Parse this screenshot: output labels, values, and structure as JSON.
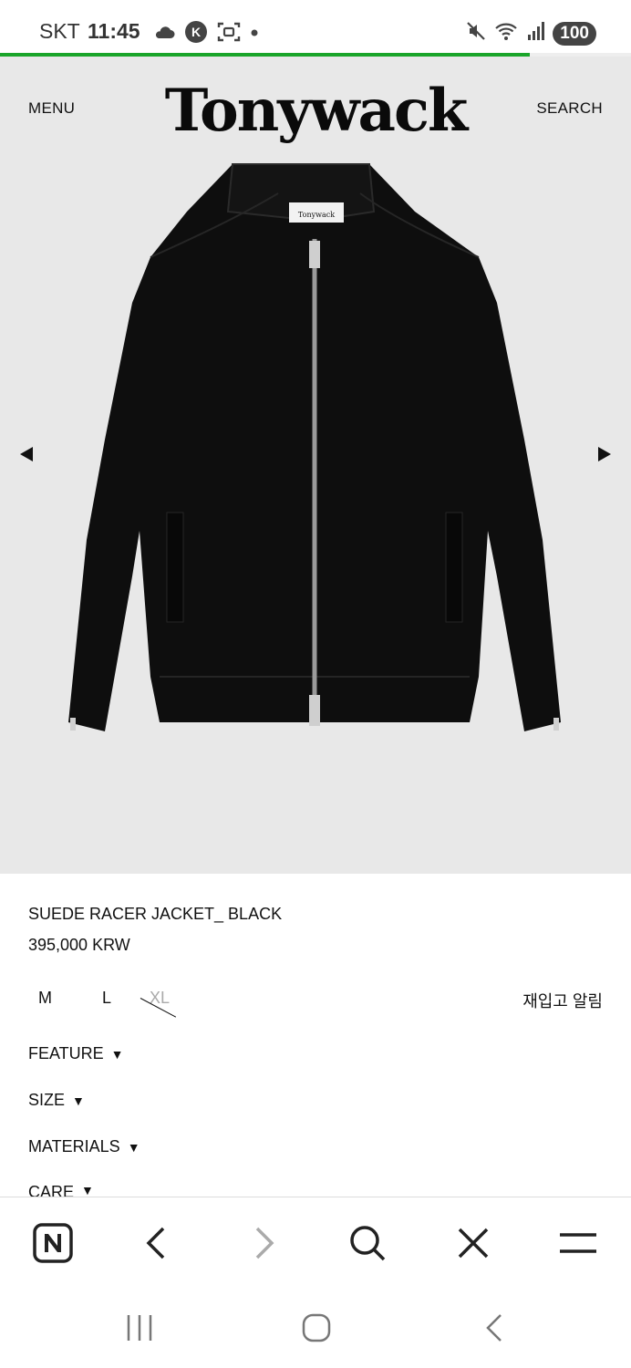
{
  "status": {
    "carrier": "SKT",
    "time": "11:45",
    "battery": "100",
    "icons": [
      "cloud-icon",
      "k-app-icon",
      "screenshot-icon",
      "dot-icon",
      "mute-icon",
      "wifi-icon",
      "signal-icon"
    ]
  },
  "load_progress": 0.84,
  "header": {
    "menu_label": "MENU",
    "logo": "Tonywack",
    "search_label": "SEARCH"
  },
  "product": {
    "name": "SUEDE RACER JACKET_ BLACK",
    "price": "395,000 KRW",
    "sizes": [
      {
        "label": "M",
        "available": true
      },
      {
        "label": "L",
        "available": true
      },
      {
        "label": "XL",
        "available": false
      }
    ],
    "restock_label": "재입고 알림",
    "tag_text": "Tonywack"
  },
  "sections": [
    {
      "label": "FEATURE",
      "marker": "▼"
    },
    {
      "label": "SIZE",
      "marker": "▼"
    },
    {
      "label": "MATERIALS",
      "marker": "▼"
    },
    {
      "label": "CARE",
      "marker": "▼"
    }
  ],
  "browser_bar": [
    "naver-home-icon",
    "back-icon",
    "forward-icon",
    "search-icon",
    "close-icon",
    "menu-icon"
  ],
  "system_nav": [
    "recents-icon",
    "home-icon",
    "back-icon"
  ],
  "colors": {
    "hero_bg": "#e8e8e8",
    "progress": "#1aa52a",
    "jacket": "#0e0e0e"
  }
}
